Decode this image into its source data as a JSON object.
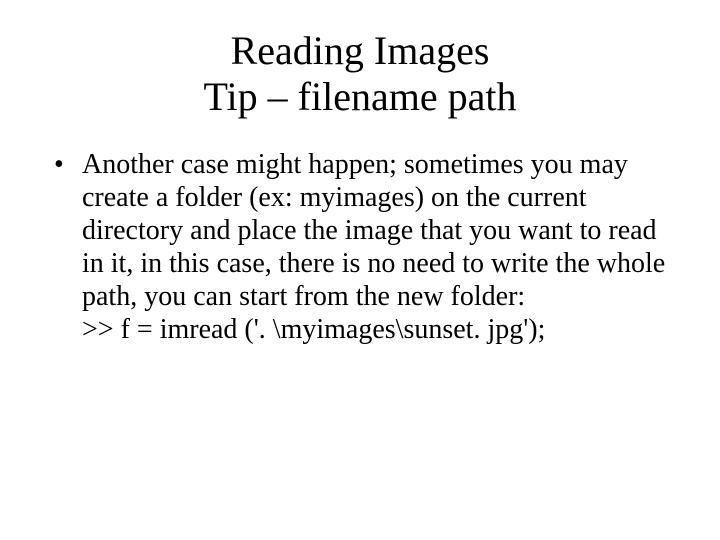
{
  "title": {
    "line1": "Reading Images",
    "line2": "Tip – filename path"
  },
  "bullet": {
    "text": "Another case might happen; sometimes you may create a folder (ex: myimages) on the current directory and place the image that you want to read in it, in this case, there is no need to write the whole path, you can start from the new folder:",
    "code": ">> f = imread ('. \\myimages\\sunset. jpg');"
  }
}
